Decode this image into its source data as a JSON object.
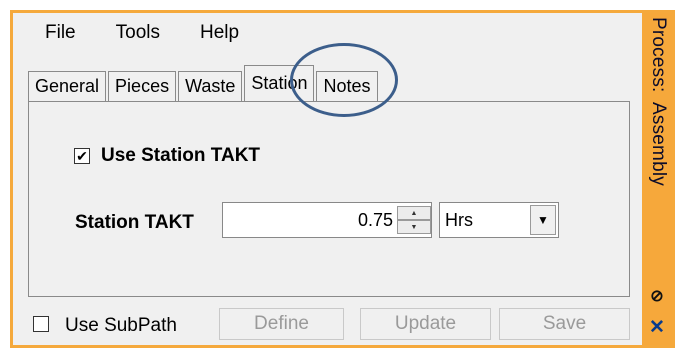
{
  "window": {
    "title": "Process: Assembly",
    "title_parts": [
      "Process:",
      "Assembly"
    ],
    "accent_color": "#f5a93c"
  },
  "menu": {
    "items": [
      "File",
      "Tools",
      "Help"
    ]
  },
  "tabs": {
    "items": [
      "General",
      "Pieces",
      "Waste",
      "Station",
      "Notes"
    ],
    "active": "Station"
  },
  "station": {
    "use_takt_label": "Use Station TAKT",
    "use_takt_checked": true,
    "takt_label": "Station TAKT",
    "takt_value": "0.75",
    "unit": "Hrs"
  },
  "footer": {
    "use_subpath_label": "Use SubPath",
    "use_subpath_checked": false,
    "define_label": "Define",
    "update_label": "Update",
    "save_label": "Save"
  },
  "icons": {
    "pin": "pin-icon",
    "close": "close-icon",
    "check": "check-icon"
  }
}
